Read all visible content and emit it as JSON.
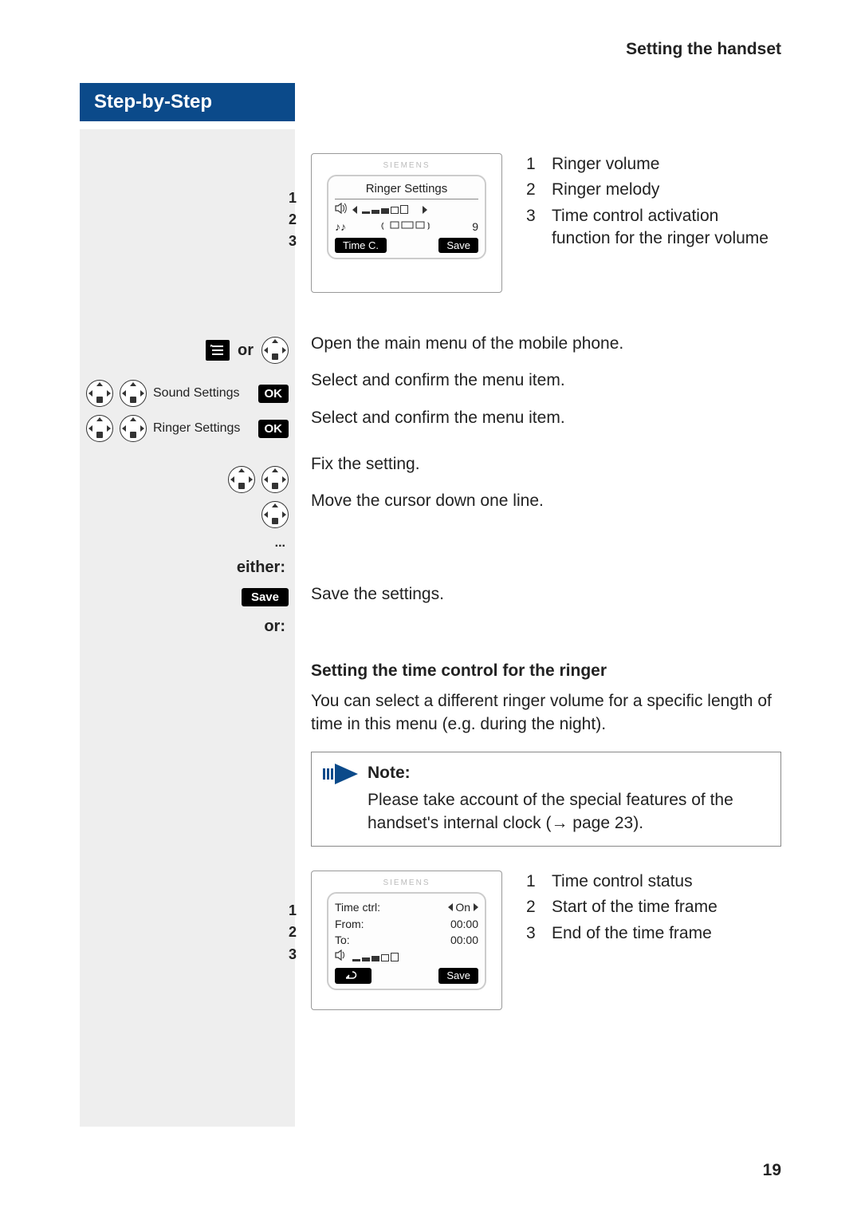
{
  "header": {
    "section": "Setting the handset"
  },
  "bluebar": {
    "title": "Step-by-Step"
  },
  "screen1": {
    "brand": "SIEMENS",
    "title": "Ringer Settings",
    "melody_value": "9",
    "soft_left": "Time C.",
    "soft_right": "Save",
    "callouts": [
      "1",
      "2",
      "3"
    ],
    "legend": [
      {
        "n": "1",
        "t": "Ringer volume"
      },
      {
        "n": "2",
        "t": "Ringer melody"
      },
      {
        "n": "3",
        "t": "Time control activation function for the ringer volume"
      }
    ]
  },
  "steps": {
    "or": "or",
    "open_menu": "Open the main menu of the mobile phone.",
    "sound_settings": "Sound Settings",
    "ringer_settings": "Ringer Settings",
    "ok": "OK",
    "select_confirm": "Select and confirm the menu item.",
    "fix": "Fix the setting.",
    "move": "Move the cursor down one line.",
    "dots": "...",
    "either": "either:",
    "save_label": "Save",
    "save_text": "Save the settings.",
    "or2": "or:"
  },
  "timecontrol": {
    "heading": "Setting the time control for the ringer",
    "para": "You can select a different ringer volume for a specific length of time in this menu (e.g. during the night)."
  },
  "note": {
    "title": "Note:",
    "body_a": "Please take account of the special features of the handset's internal clock (",
    "page_ref": " page 23).",
    "arrow": "→"
  },
  "screen2": {
    "brand": "SIEMENS",
    "row1_label": "Time ctrl:",
    "row1_val": "On",
    "row2_label": "From:",
    "row2_val": "00:00",
    "row3_label": "To:",
    "row3_val": "00:00",
    "soft_right": "Save",
    "callouts": [
      "1",
      "2",
      "3"
    ],
    "legend": [
      {
        "n": "1",
        "t": "Time control status"
      },
      {
        "n": "2",
        "t": "Start of the time frame"
      },
      {
        "n": "3",
        "t": "End of the time frame"
      }
    ]
  },
  "page": {
    "num": "19"
  }
}
